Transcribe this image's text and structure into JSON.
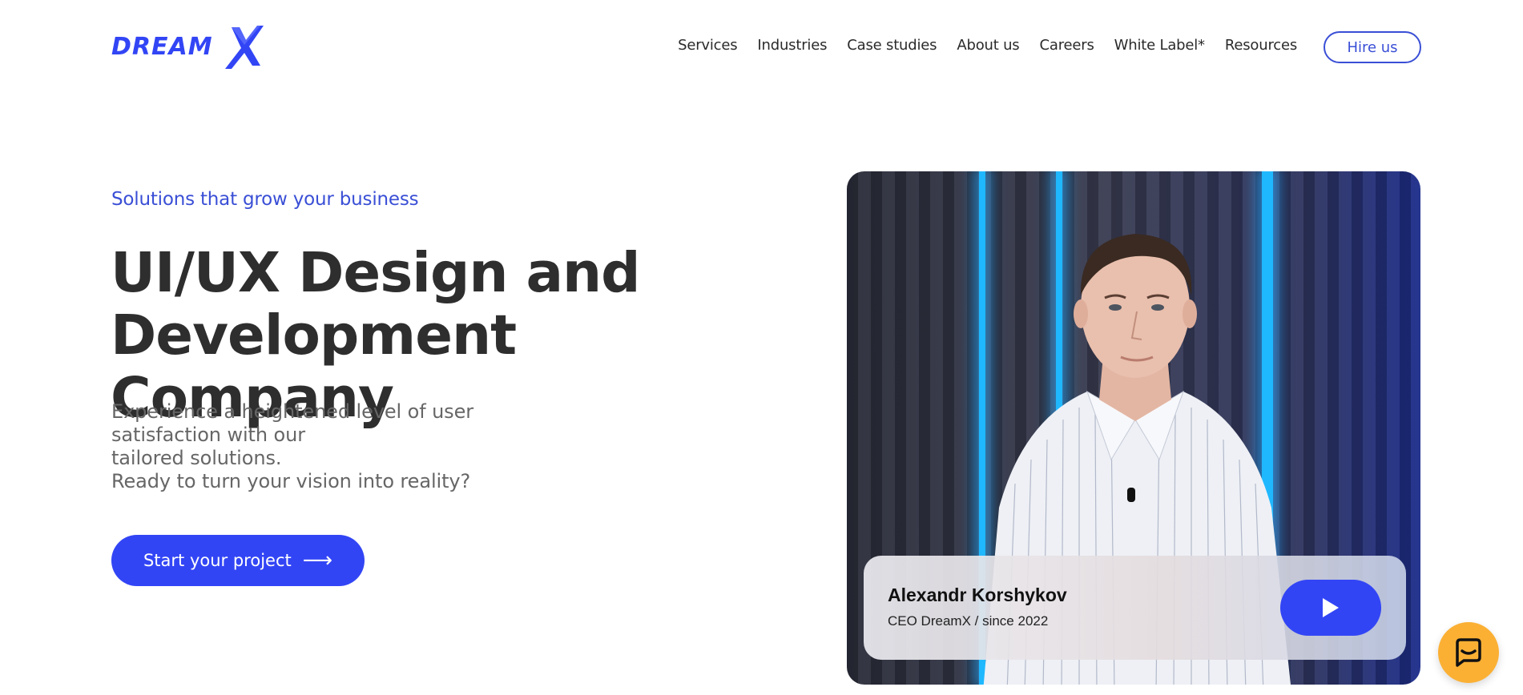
{
  "brand": {
    "logo_text": "DREAMX",
    "accent": "#3245f5"
  },
  "nav": {
    "items": [
      {
        "label": "Services"
      },
      {
        "label": "Industries"
      },
      {
        "label": "Case studies"
      },
      {
        "label": "About us"
      },
      {
        "label": "Careers"
      },
      {
        "label": "White Label*"
      },
      {
        "label": "Resources"
      }
    ],
    "cta_label": "Hire us"
  },
  "hero": {
    "eyebrow": "Solutions that grow your business",
    "title_line1": "UI/UX Design and",
    "title_line2": "Development Company",
    "sub_lines": [
      "Experience a heightened level of user",
      "satisfaction with our",
      "tailored solutions.",
      "Ready to turn your vision into reality?"
    ],
    "cta_label": "Start your project",
    "cta_icon": "arrow-right-icon"
  },
  "video": {
    "name": "Alexandr Korshykov",
    "role": "CEO DreamX / since 2022",
    "play_icon": "play-icon"
  },
  "chat": {
    "icon": "chat-bubble-icon",
    "color": "#fbb034"
  }
}
